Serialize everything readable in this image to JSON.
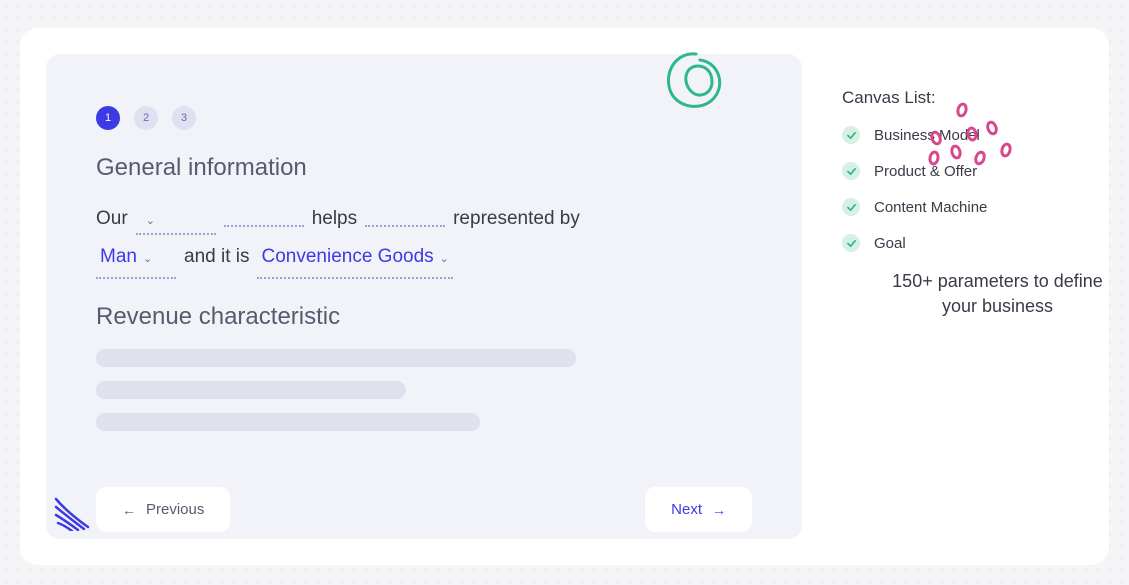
{
  "steps": {
    "items": [
      "1",
      "2",
      "3"
    ],
    "active_index": 0
  },
  "sections": {
    "general_info": {
      "title": "General information",
      "word_our": "Our",
      "word_helps": "helps",
      "word_represented_by": "represented by",
      "word_and_it_is": "and it is",
      "field1": {
        "value": ""
      },
      "field2": {
        "value": ""
      },
      "field3": {
        "value": ""
      },
      "field4": {
        "value": "Man"
      },
      "field5": {
        "value": "Convenience Goods"
      }
    },
    "revenue": {
      "title": "Revenue characteristic"
    }
  },
  "nav": {
    "previous": "Previous",
    "next": "Next"
  },
  "sidebar": {
    "title": "Canvas List:",
    "items": [
      {
        "label": "Business Model"
      },
      {
        "label": "Product & Offer"
      },
      {
        "label": "Content Machine"
      },
      {
        "label": "Goal"
      }
    ],
    "tagline": "150+ parameters to define your business"
  }
}
